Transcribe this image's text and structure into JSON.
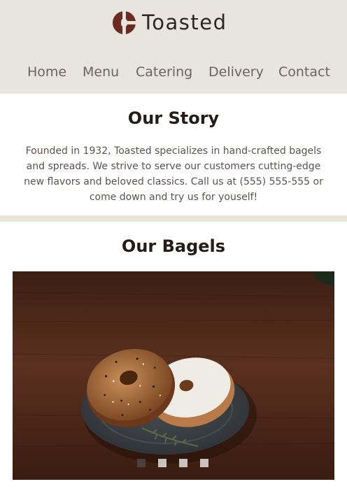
{
  "brand": {
    "name": "Toasted",
    "logo_icon": "toasted-logo-icon"
  },
  "nav": {
    "items": [
      {
        "label": "Home"
      },
      {
        "label": "Menu"
      },
      {
        "label": "Catering"
      },
      {
        "label": "Delivery"
      },
      {
        "label": "Contact"
      }
    ]
  },
  "story": {
    "title": "Our Story",
    "text": "Founded in 1932, Toasted specializes in hand-crafted bagels and spreads. We strive to serve our customers cutting-edge new flavors and beloved classics. Call us at (555) 555-555 or come down and try us for youself!"
  },
  "bagels": {
    "title": "Our Bagels",
    "carousel": {
      "slide_count": 4,
      "active_slide": 1
    }
  },
  "colors": {
    "header_bg": "#e8e5df",
    "brand_dark": "#2f2522",
    "nav_text": "#6a6460",
    "body_text": "#5a5350"
  }
}
